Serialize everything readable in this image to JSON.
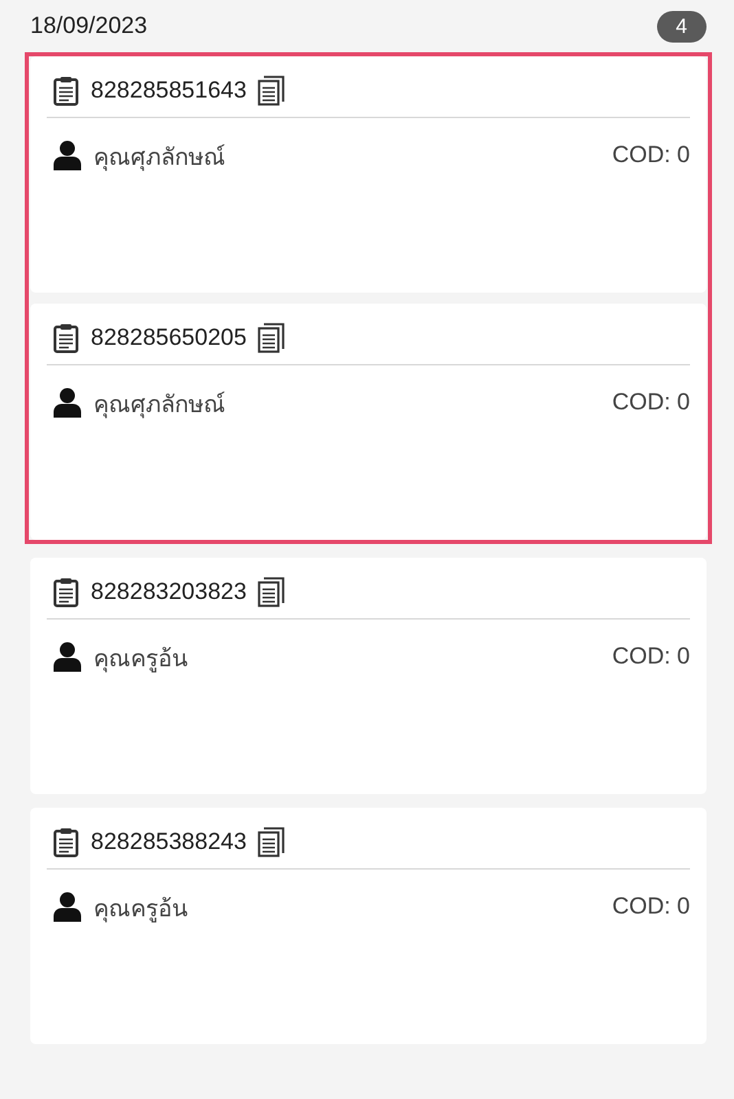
{
  "header": {
    "date": "18/09/2023",
    "count": "4"
  },
  "orders": [
    {
      "tracking": "828285851643",
      "customer": "คุณศุภลักษณ์",
      "cod": "COD: 0",
      "selected": true
    },
    {
      "tracking": "828285650205",
      "customer": "คุณศุภลักษณ์",
      "cod": "COD: 0",
      "selected": true
    },
    {
      "tracking": "828283203823",
      "customer": "คุณครูอ้น",
      "cod": "COD: 0",
      "selected": false
    },
    {
      "tracking": "828285388243",
      "customer": "คุณครูอ้น",
      "cod": "COD: 0",
      "selected": false
    }
  ]
}
